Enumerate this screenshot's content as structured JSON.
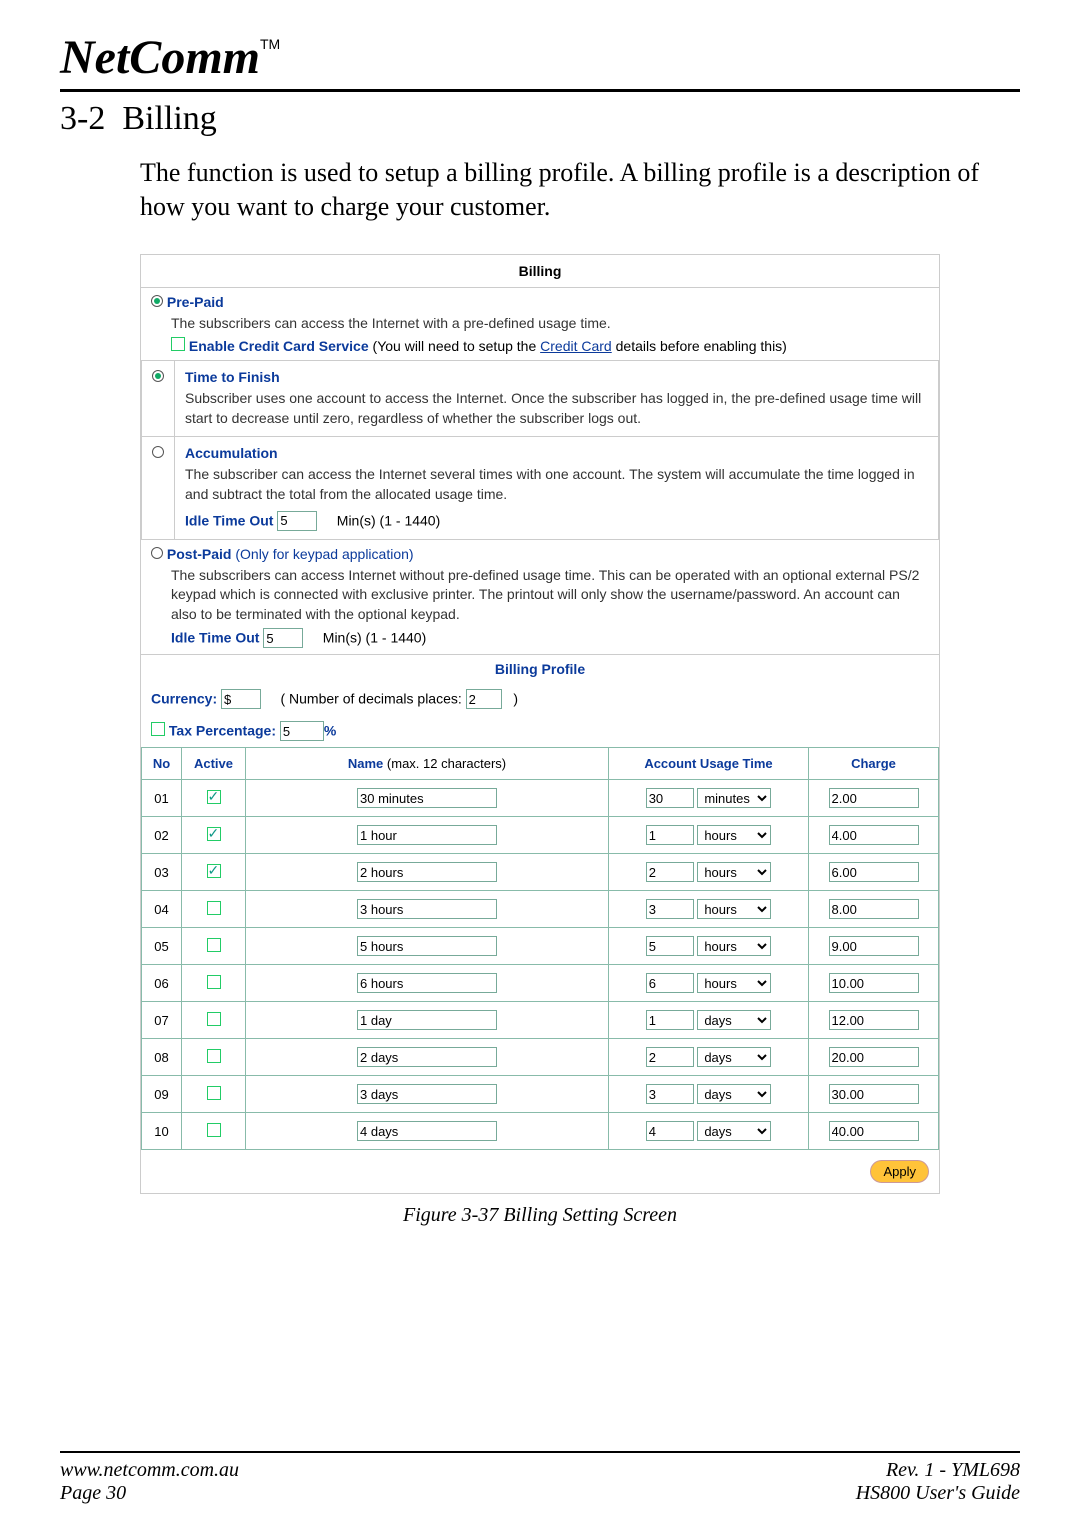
{
  "logo": {
    "brand": "NetComm",
    "tm": "TM"
  },
  "section": {
    "number": "3-2",
    "title": "Billing"
  },
  "intro": "The function is used to setup a billing profile. A billing profile is a description of how you want to charge your customer.",
  "billing": {
    "title": "Billing",
    "prepaid": {
      "label": "Pre-Paid",
      "desc": "The subscribers can access the Internet with a pre-defined usage time.",
      "cc_label": "Enable Credit Card Service",
      "cc_hint_a": " (You will need to setup the ",
      "cc_link": "Credit Card",
      "cc_hint_b": " details before enabling this)",
      "time_to_finish": {
        "label": "Time to Finish",
        "desc": "Subscriber uses one account to access the Internet.  Once the subscriber has logged in, the pre-defined usage time will start to decrease until zero, regardless of whether the subscriber logs out."
      },
      "accumulation": {
        "label": "Accumulation",
        "desc": "The subscriber can access the Internet several times with one account. The system will accumulate the time logged in and subtract the total from the allocated usage time.",
        "idle_label": "Idle Time Out",
        "idle_value": "5",
        "idle_hint": "Min(s) (1 - 1440)"
      }
    },
    "postpaid": {
      "label": "Post-Paid",
      "subtitle": "  (Only for keypad application)",
      "desc": "The subscribers can access Internet without pre-defined usage time. This can be operated with an optional external PS/2 keypad which is connected with exclusive printer. The printout will only show the username/password. An account can also to be terminated with the optional keypad.",
      "idle_label": "Idle Time Out",
      "idle_value": "5",
      "idle_hint": "Min(s) (1 - 1440)"
    }
  },
  "profile": {
    "title": "Billing Profile",
    "currency_label": "Currency:",
    "currency_value": "$",
    "decimals_label": "( Number of decimals places:",
    "decimals_value": "2",
    "decimals_close": ")",
    "tax_label": "Tax Percentage:",
    "tax_value": "5",
    "tax_unit": "%",
    "headers": {
      "no": "No",
      "active": "Active",
      "name": "Name",
      "name_hint": " (max. 12 characters)",
      "usage": "Account Usage Time",
      "charge": "Charge"
    },
    "rows": [
      {
        "no": "01",
        "active": true,
        "name": "30 minutes",
        "qty": "30",
        "unit": "minutes",
        "charge": "2.00"
      },
      {
        "no": "02",
        "active": true,
        "name": "1 hour",
        "qty": "1",
        "unit": "hours",
        "charge": "4.00"
      },
      {
        "no": "03",
        "active": true,
        "name": "2 hours",
        "qty": "2",
        "unit": "hours",
        "charge": "6.00"
      },
      {
        "no": "04",
        "active": false,
        "name": "3 hours",
        "qty": "3",
        "unit": "hours",
        "charge": "8.00"
      },
      {
        "no": "05",
        "active": false,
        "name": "5 hours",
        "qty": "5",
        "unit": "hours",
        "charge": "9.00"
      },
      {
        "no": "06",
        "active": false,
        "name": "6 hours",
        "qty": "6",
        "unit": "hours",
        "charge": "10.00"
      },
      {
        "no": "07",
        "active": false,
        "name": "1 day",
        "qty": "1",
        "unit": "days",
        "charge": "12.00"
      },
      {
        "no": "08",
        "active": false,
        "name": "2 days",
        "qty": "2",
        "unit": "days",
        "charge": "20.00"
      },
      {
        "no": "09",
        "active": false,
        "name": "3 days",
        "qty": "3",
        "unit": "days",
        "charge": "30.00"
      },
      {
        "no": "10",
        "active": false,
        "name": "4 days",
        "qty": "4",
        "unit": "days",
        "charge": "40.00"
      }
    ],
    "apply": "Apply"
  },
  "figure": "Figure 3-37 Billing Setting Screen",
  "footer": {
    "url": "www.netcomm.com.au",
    "page": "Page 30",
    "rev": "Rev. 1 - YML698",
    "guide": "HS800 User's Guide"
  }
}
